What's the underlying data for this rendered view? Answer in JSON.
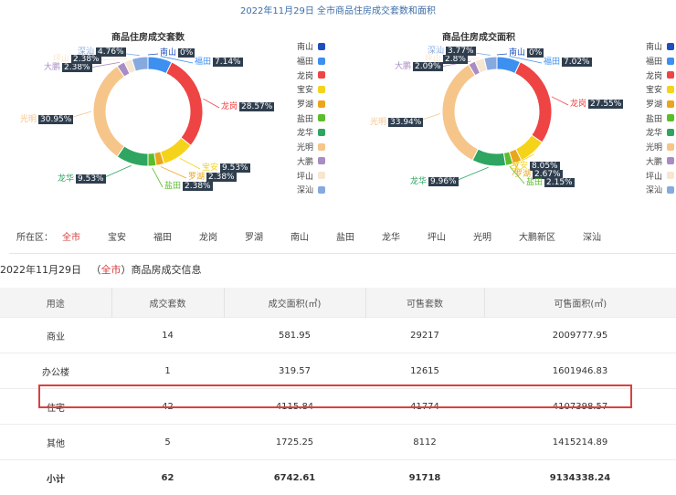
{
  "header": {
    "title": "2022年11月29日 全市商品住房成交套数和面积"
  },
  "legend_colors": {
    "南山": "#1f4fbd",
    "福田": "#3d8ff0",
    "龙岗": "#ee4444",
    "宝安": "#f5d31a",
    "罗湖": "#eaa51a",
    "盐田": "#5bbd2b",
    "龙华": "#2ea561",
    "光明": "#f6c58a",
    "大鹏": "#a98cc4",
    "坪山": "#f7e6d0",
    "深汕": "#86a9e0"
  },
  "chart_data": [
    {
      "type": "pie",
      "title": "商品住房成交套数",
      "categories": [
        "南山",
        "福田",
        "龙岗",
        "宝安",
        "罗湖",
        "盐田",
        "龙华",
        "光明",
        "大鹏",
        "坪山",
        "深汕"
      ],
      "values": [
        0,
        7.14,
        28.57,
        9.53,
        2.38,
        2.38,
        9.53,
        30.95,
        2.38,
        2.38,
        4.76
      ],
      "labels": [
        "0%",
        "7.14%",
        "28.57%",
        "9.53%",
        "2.38%",
        "2.38%",
        "9.53%",
        "30.95%",
        "2.38%",
        "2.38%",
        "4.76%"
      ],
      "legend": "right"
    },
    {
      "type": "pie",
      "title": "商品住房成交面积",
      "categories": [
        "南山",
        "福田",
        "龙岗",
        "宝安",
        "罗湖",
        "盐田",
        "龙华",
        "光明",
        "大鹏",
        "坪山",
        "深汕"
      ],
      "values": [
        0,
        7.02,
        27.55,
        8.05,
        2.67,
        2.15,
        9.96,
        33.94,
        2.09,
        2.8,
        3.77
      ],
      "labels": [
        "0%",
        "7.02%",
        "27.55%",
        "8.05%",
        "2.67%",
        "2.15%",
        "9.96%",
        "33.94%",
        "2.09%",
        "2.8%",
        "3.77%"
      ],
      "legend": "right"
    }
  ],
  "filter": {
    "label": "所在区：",
    "items": [
      "全市",
      "宝安",
      "福田",
      "龙岗",
      "罗湖",
      "南山",
      "盐田",
      "龙华",
      "坪山",
      "光明",
      "大鹏新区",
      "深汕"
    ],
    "active": "全市"
  },
  "info": {
    "date": "2022年11月29日",
    "open": "（",
    "area": "全市",
    "close": "）",
    "suffix": "商品房成交信息"
  },
  "table": {
    "headers": [
      "用途",
      "成交套数",
      "成交面积(㎡)",
      "可售套数",
      "可售面积(㎡)"
    ],
    "rows": [
      [
        "商业",
        "14",
        "581.95",
        "29217",
        "2009777.95"
      ],
      [
        "办公楼",
        "1",
        "319.57",
        "12615",
        "1601946.83"
      ],
      [
        "住宅",
        "42",
        "4115.84",
        "41774",
        "4107398.57"
      ],
      [
        "其他",
        "5",
        "1725.25",
        "8112",
        "1415214.89"
      ],
      [
        "小计",
        "62",
        "6742.61",
        "91718",
        "9134338.24"
      ]
    ]
  }
}
